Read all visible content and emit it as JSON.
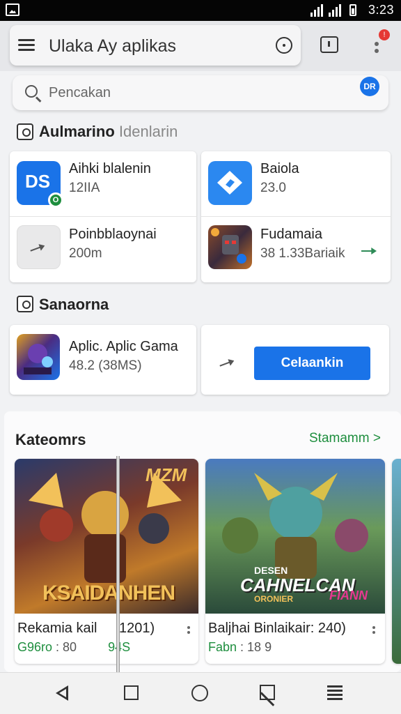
{
  "status_bar": {
    "time": "3:23"
  },
  "app_bar": {
    "title": "Ulaka Ay aplikas"
  },
  "search": {
    "placeholder": "Pencakan",
    "mic_label": "DR"
  },
  "notifications": {
    "badge": "!"
  },
  "section_installed": {
    "title": "Aulmarino",
    "subtitle": "Idenlarin",
    "apps": [
      {
        "name": "Aihki blalenin",
        "meta": "12IIA",
        "icon_text": "DS",
        "icon_color": "#1a73e8",
        "badge": "O"
      },
      {
        "name": "Baiola",
        "meta": "23.0",
        "icon_color": "#2b88f0"
      },
      {
        "name": "Poinbblaoynai",
        "meta": "200m",
        "icon_color": "#e9e9ea"
      },
      {
        "name": "Fudamaia",
        "meta": "38 1.33Bariaik",
        "icon_color": "#6b3b2a"
      }
    ]
  },
  "section_games": {
    "title": "Sanaorna",
    "app": {
      "name": "Aplic. Aplic Gama",
      "meta": "48.2 (38MS)",
      "icon_color": "#4b2c82"
    },
    "button_label": "Celaankin"
  },
  "categories": {
    "title": "Kateomrs",
    "see_all": "Stamamm >",
    "items": [
      {
        "title": "Rekamia kail",
        "extra": "1201)",
        "rating": "G96ro",
        "size": ": 80",
        "size2": "94S",
        "banner": "KSAIDANHEN",
        "tag": "MZM"
      },
      {
        "title": "Baljhai Binlaikair: 240)",
        "rating": "Fabn",
        "size": ": 18 9",
        "banner": "CAHNELCAN",
        "banner_top": "DESEN",
        "banner_bottom": "ORONIER",
        "tag": "FIANN"
      }
    ]
  }
}
